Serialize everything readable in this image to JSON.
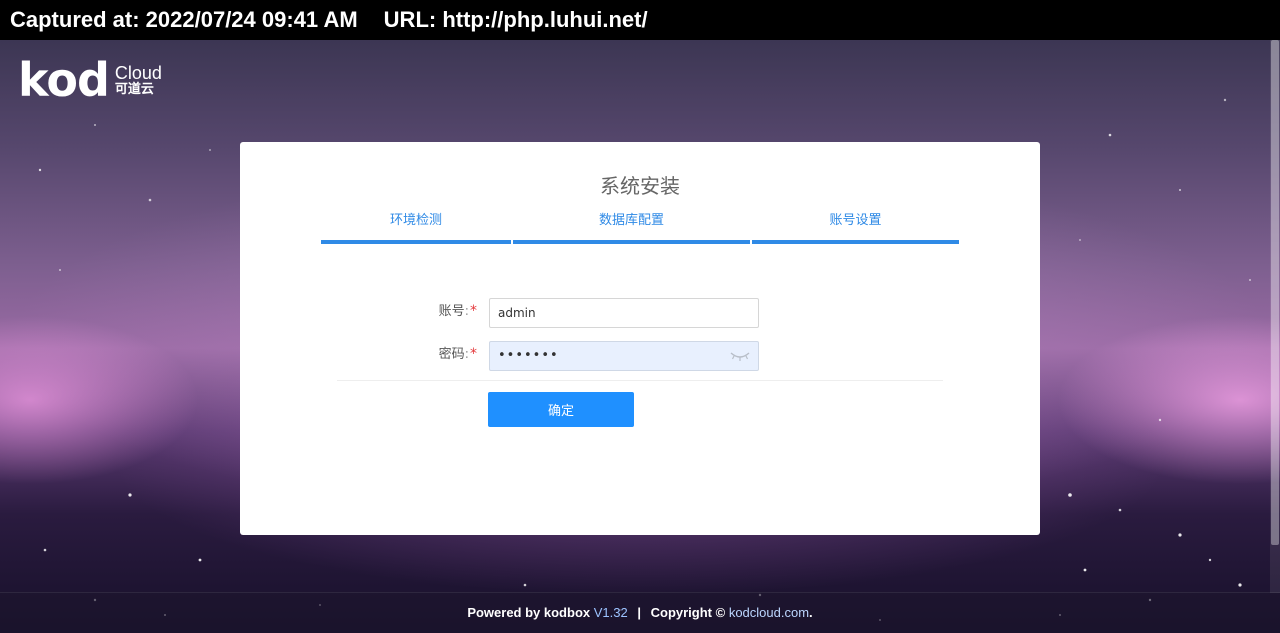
{
  "capture_bar": {
    "captured": "Captured at: 2022/07/24 09:41 AM",
    "url": "URL: http://php.luhui.net/"
  },
  "logo": {
    "mark": "kod",
    "cloud": "Cloud",
    "cn": "可道云"
  },
  "install": {
    "title": "系统安装",
    "steps": [
      {
        "label": "环境检测"
      },
      {
        "label": "数据库配置"
      },
      {
        "label": "账号设置"
      }
    ],
    "fields": {
      "user": {
        "label": "账号",
        "colon": ":",
        "required": "*",
        "value": "admin"
      },
      "pass": {
        "label": "密码",
        "colon": ":",
        "required": "*",
        "value": "•••••••"
      }
    },
    "submit_label": "确定"
  },
  "footer": {
    "powered": "Powered by kodbox",
    "version": "V1.32",
    "divider": "|",
    "copyright": "Copyright ©",
    "site": "kodcloud.com",
    "tail": "."
  },
  "colors": {
    "accent": "#2f8ae6",
    "button": "#1f90ff",
    "required": "#e4393c"
  }
}
